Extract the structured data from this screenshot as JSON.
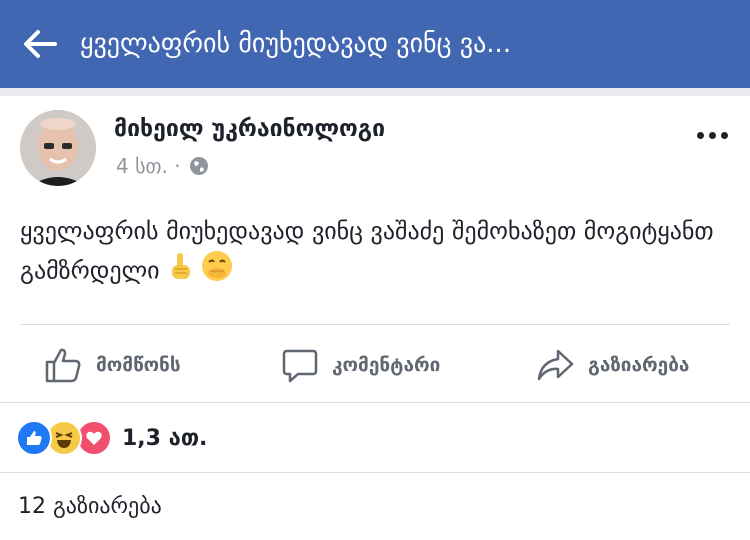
{
  "header": {
    "title": "ყველაფრის მიუხედავად ვინც ვა...",
    "back_icon": "arrow-left-icon",
    "bg_color": "#4267b2"
  },
  "post": {
    "author": "მიხეილ უკრაინოლოგი",
    "time": "4 სთ. ·",
    "text": "ყველაფრის მიუხედავად ვინც ვაშაძე შემოხაზეთ მოგიტყანთ გამზრდელი",
    "emojis": [
      "pointing-up-icon",
      "hand-over-mouth-smile-icon"
    ]
  },
  "actions": {
    "like": "მომწონს",
    "comment": "კომენტარი",
    "share": "გაზიარება"
  },
  "reactions": {
    "count": "1,3 ათ.",
    "icons": [
      "like-reaction-icon",
      "haha-reaction-icon",
      "love-reaction-icon"
    ]
  },
  "shares": {
    "text": "12 გაზიარება"
  }
}
